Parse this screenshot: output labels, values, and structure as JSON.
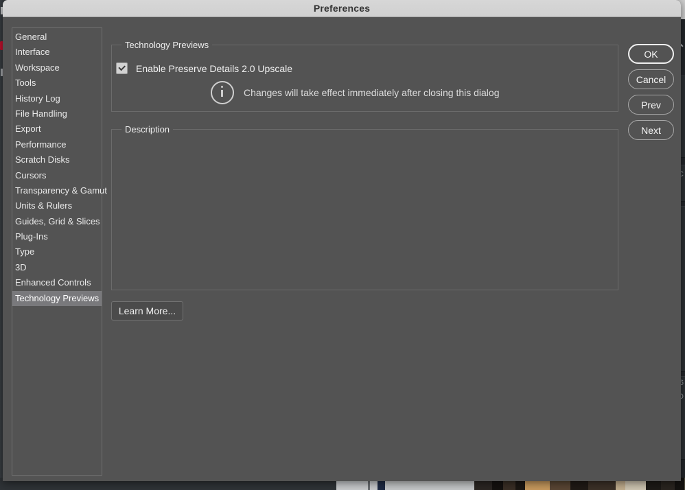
{
  "dialog": {
    "title": "Preferences",
    "sidebar": {
      "name": "preference-categories",
      "items": [
        {
          "label": "General",
          "selected": false
        },
        {
          "label": "Interface",
          "selected": false
        },
        {
          "label": "Workspace",
          "selected": false
        },
        {
          "label": "Tools",
          "selected": false
        },
        {
          "label": "History Log",
          "selected": false
        },
        {
          "label": "File Handling",
          "selected": false
        },
        {
          "label": "Export",
          "selected": false
        },
        {
          "label": "Performance",
          "selected": false
        },
        {
          "label": "Scratch Disks",
          "selected": false
        },
        {
          "label": "Cursors",
          "selected": false
        },
        {
          "label": "Transparency & Gamut",
          "selected": false
        },
        {
          "label": "Units & Rulers",
          "selected": false
        },
        {
          "label": "Guides, Grid & Slices",
          "selected": false
        },
        {
          "label": "Plug-Ins",
          "selected": false
        },
        {
          "label": "Type",
          "selected": false
        },
        {
          "label": "3D",
          "selected": false
        },
        {
          "label": "Enhanced Controls",
          "selected": false
        },
        {
          "label": "Technology Previews",
          "selected": true
        }
      ]
    },
    "groups": {
      "technology_previews": {
        "label": "Technology Previews",
        "checkbox": {
          "label": "Enable Preserve Details 2.0 Upscale",
          "checked": true
        },
        "info": {
          "icon": "info-circle-icon",
          "text": "Changes will take effect immediately after closing this dialog"
        }
      },
      "description": {
        "label": "Description",
        "text": ""
      }
    },
    "learn_more_label": "Learn More...",
    "actions": [
      {
        "label": "OK",
        "name": "ok-button",
        "default": true
      },
      {
        "label": "Cancel",
        "name": "cancel-button",
        "default": false
      },
      {
        "label": "Prev",
        "name": "prev-button",
        "default": false
      },
      {
        "label": "Next",
        "name": "next-button",
        "default": false
      }
    ]
  },
  "colors": {
    "dialog_background": "#535353",
    "titlebar_background": "#d3d3d3",
    "titlebar_text": "#333333",
    "selection_background": "#79797c",
    "group_border": "#6b6b6b",
    "text_primary": "#eeeeee",
    "checkbox_fill": "#d2d2d2",
    "accent_red": "#c8102e"
  }
}
